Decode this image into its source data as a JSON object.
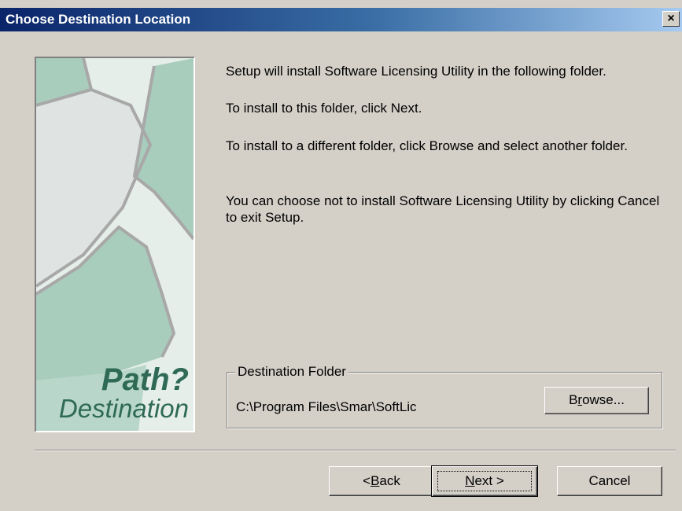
{
  "window": {
    "title": "Choose Destination Location",
    "close_label": "X"
  },
  "art": {
    "caption_line1": "Path?",
    "caption_line2": "Destination"
  },
  "content": {
    "paragraphs": [
      "Setup will install Software Licensing Utility in the following folder.",
      "To install to this folder, click Next.",
      "To install to a different folder, click Browse and select another folder.",
      "You can choose not to install Software Licensing Utility by clicking Cancel to exit Setup."
    ]
  },
  "destination": {
    "legend": "Destination Folder",
    "path": "C:\\Program Files\\Smar\\SoftLic",
    "browse_pre": "B",
    "browse_key": "r",
    "browse_post": "owse..."
  },
  "buttons": {
    "back_pre": "< ",
    "back_key": "B",
    "back_post": "ack",
    "next_key": "N",
    "next_post": "ext >",
    "cancel": "Cancel"
  },
  "colors": {
    "title_gradient_start": "#0a246a",
    "title_gradient_end": "#a6caf0",
    "dialog_bg": "#d4d0c8",
    "art_green": "#2f6a57"
  }
}
